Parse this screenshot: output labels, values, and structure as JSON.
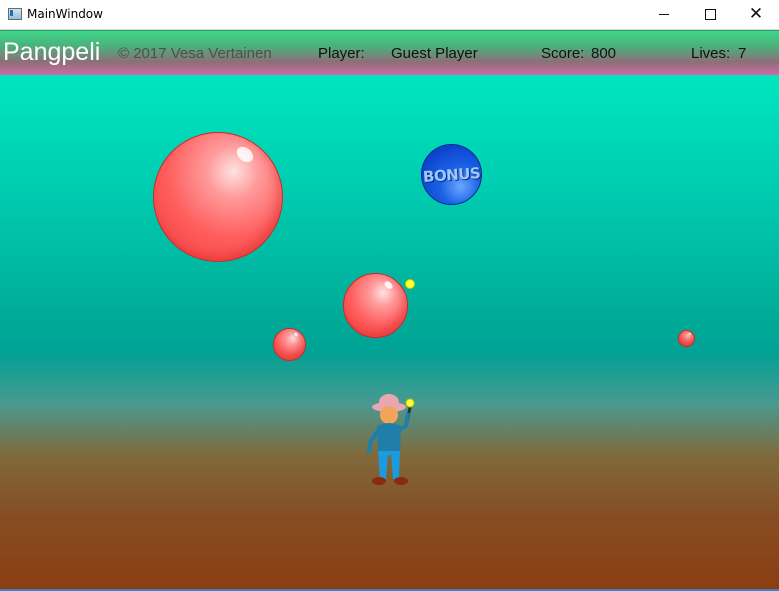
{
  "window": {
    "title": "MainWindow",
    "controls": {
      "minimize": "minimize",
      "maximize": "maximize",
      "close": "✕"
    }
  },
  "header": {
    "brand": "Pangpeli",
    "copyright": "© 2017   Vesa Vertainen",
    "player_label": "Player:",
    "player_name": "Guest Player",
    "score_label": "Score:",
    "score_value": "800",
    "lives_label": "Lives:",
    "lives_value": "7"
  },
  "game": {
    "bonus_text": "BONUS",
    "colors": {
      "bubble": "#ff5e5e",
      "bonus_bubble": "#1a61e6",
      "spark": "#ffff33",
      "sky_top": "#00e6c0",
      "ground": "#8a3e10"
    }
  }
}
